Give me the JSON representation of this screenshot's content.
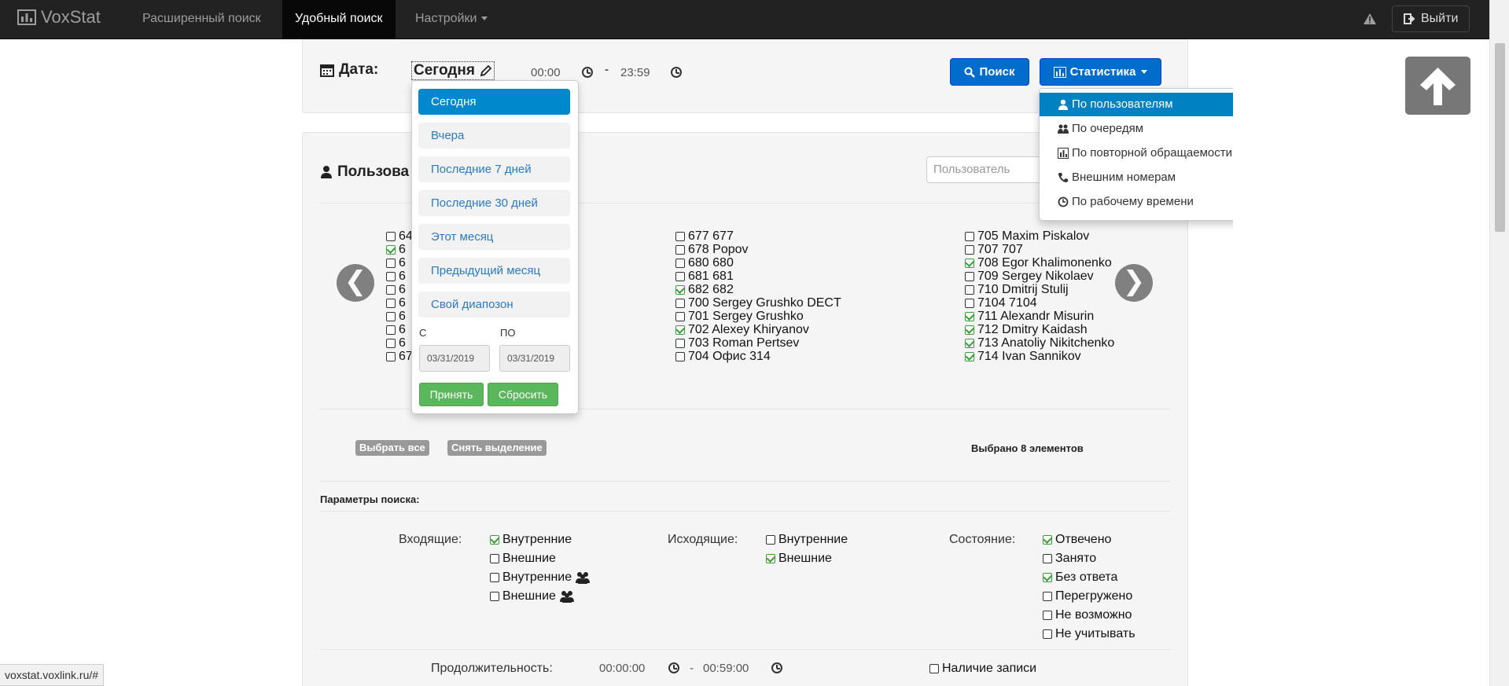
{
  "navbar": {
    "brand": "VoxStat",
    "links": [
      "Расширенный поиск",
      "Удобный поиск",
      "Настройки"
    ],
    "exit_label": "Выйти"
  },
  "date_filter": {
    "label": "Дата:",
    "range_value": "Сегодня",
    "time_from": "00:00",
    "dash": "-",
    "time_to": "23:59",
    "search_label": "Поиск",
    "stats_label": "Статистика"
  },
  "range_menu": {
    "items": [
      "Сегодня",
      "Вчера",
      "Последние 7 дней",
      "Последние 30 дней",
      "Этот месяц",
      "Предыдущий месяц",
      "Свой диапозон"
    ],
    "from_label": "С",
    "to_label": "ПО",
    "from_value": "03/31/2019",
    "to_value": "03/31/2019",
    "apply_label": "Принять",
    "reset_label": "Сбросить"
  },
  "stats_menu": {
    "items": [
      "По пользователям",
      "По очередям",
      "По повторной обращаемости",
      "Внешним номерам",
      "По рабочему времени"
    ]
  },
  "users": {
    "title": "Пользова",
    "search_placeholder": "Пользователь",
    "col1": [
      {
        "label": "64",
        "checked": false
      },
      {
        "label": "6",
        "checked": true
      },
      {
        "label": "6",
        "checked": false
      },
      {
        "label": "6",
        "checked": false
      },
      {
        "label": "6",
        "checked": false
      },
      {
        "label": "6",
        "checked": false
      },
      {
        "label": "6",
        "checked": false
      },
      {
        "label": "6",
        "checked": false
      },
      {
        "label": "6",
        "checked": false
      },
      {
        "label": "67",
        "checked": false
      }
    ],
    "col2": [
      {
        "label": "677 677",
        "checked": false
      },
      {
        "label": "678 Popov",
        "checked": false
      },
      {
        "label": "680 680",
        "checked": false
      },
      {
        "label": "681 681",
        "checked": false
      },
      {
        "label": "682 682",
        "checked": true
      },
      {
        "label": "700 Sergey Grushko DECT",
        "checked": false
      },
      {
        "label": "701 Sergey Grushko",
        "checked": false
      },
      {
        "label": "702 Alexey Khiryanov",
        "checked": true
      },
      {
        "label": "703 Roman Pertsev",
        "checked": false
      },
      {
        "label": "704 Офис 314",
        "checked": false
      }
    ],
    "col3": [
      {
        "label": "705 Maxim Piskalov",
        "checked": false
      },
      {
        "label": "707 707",
        "checked": false
      },
      {
        "label": "708 Egor Khalimonenko",
        "checked": true
      },
      {
        "label": "709 Sergey Nikolaev",
        "checked": false
      },
      {
        "label": "710 Dmitrij Stulij",
        "checked": false
      },
      {
        "label": "7104 7104",
        "checked": false
      },
      {
        "label": "711 Alexandr Misurin",
        "checked": true
      },
      {
        "label": "712 Dmitry Kaidash",
        "checked": true
      },
      {
        "label": "713 Anatoliy Nikitchenko",
        "checked": true
      },
      {
        "label": "714 Ivan Sannikov",
        "checked": true
      }
    ],
    "select_all": "Выбрать все",
    "deselect": "Снять выделение",
    "selected_count": "Выбрано 8 элементов"
  },
  "params": {
    "title": "Параметры поиска:",
    "incoming_label": "Входящие:",
    "incoming": [
      {
        "label": "Внутренние",
        "checked": true,
        "group": false
      },
      {
        "label": "Внешние",
        "checked": false,
        "group": false
      },
      {
        "label": "Внутренние",
        "checked": false,
        "group": true
      },
      {
        "label": "Внешние",
        "checked": false,
        "group": true
      }
    ],
    "outgoing_label": "Исходящие:",
    "outgoing": [
      {
        "label": "Внутренние",
        "checked": false
      },
      {
        "label": "Внешние",
        "checked": true
      }
    ],
    "state_label": "Состояние:",
    "state": [
      {
        "label": "Отвечено",
        "checked": true
      },
      {
        "label": "Занято",
        "checked": false
      },
      {
        "label": "Без ответа",
        "checked": true
      },
      {
        "label": "Перегружено",
        "checked": false
      },
      {
        "label": "Не возможно",
        "checked": false
      },
      {
        "label": "Не учитывать",
        "checked": false
      }
    ],
    "duration_label": "Продолжительность:",
    "duration_from": "00:00:00",
    "duration_dash": "-",
    "duration_to": "00:59:00",
    "record_label": "Наличие записи"
  },
  "status_url": "voxstat.voxlink.ru/#"
}
